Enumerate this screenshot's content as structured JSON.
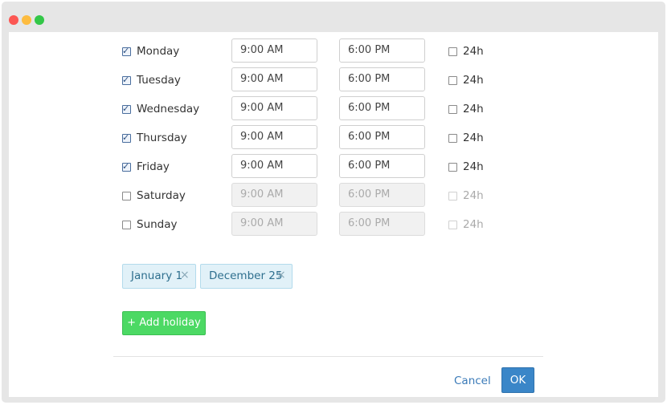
{
  "schedule": [
    {
      "day": "Monday",
      "enabled": true,
      "open": "9:00 AM",
      "close": "6:00 PM",
      "all_day_label": "24h",
      "all_day": false
    },
    {
      "day": "Tuesday",
      "enabled": true,
      "open": "9:00 AM",
      "close": "6:00 PM",
      "all_day_label": "24h",
      "all_day": false
    },
    {
      "day": "Wednesday",
      "enabled": true,
      "open": "9:00 AM",
      "close": "6:00 PM",
      "all_day_label": "24h",
      "all_day": false
    },
    {
      "day": "Thursday",
      "enabled": true,
      "open": "9:00 AM",
      "close": "6:00 PM",
      "all_day_label": "24h",
      "all_day": false
    },
    {
      "day": "Friday",
      "enabled": true,
      "open": "9:00 AM",
      "close": "6:00 PM",
      "all_day_label": "24h",
      "all_day": false
    },
    {
      "day": "Saturday",
      "enabled": false,
      "open": "9:00 AM",
      "close": "6:00 PM",
      "all_day_label": "24h",
      "all_day": false
    },
    {
      "day": "Sunday",
      "enabled": false,
      "open": "9:00 AM",
      "close": "6:00 PM",
      "all_day_label": "24h",
      "all_day": false
    }
  ],
  "holidays": [
    {
      "label": "January 1",
      "remove_icon": "×"
    },
    {
      "label": "December 25",
      "remove_icon": "×"
    }
  ],
  "actions": {
    "add_holiday": "+ Add holiday",
    "cancel": "Cancel",
    "ok": "OK"
  },
  "colors": {
    "add_button": "#4cd964",
    "ok_button": "#3a86c8",
    "tag_background": "#e1f1f8",
    "link": "#3a7ab8"
  }
}
